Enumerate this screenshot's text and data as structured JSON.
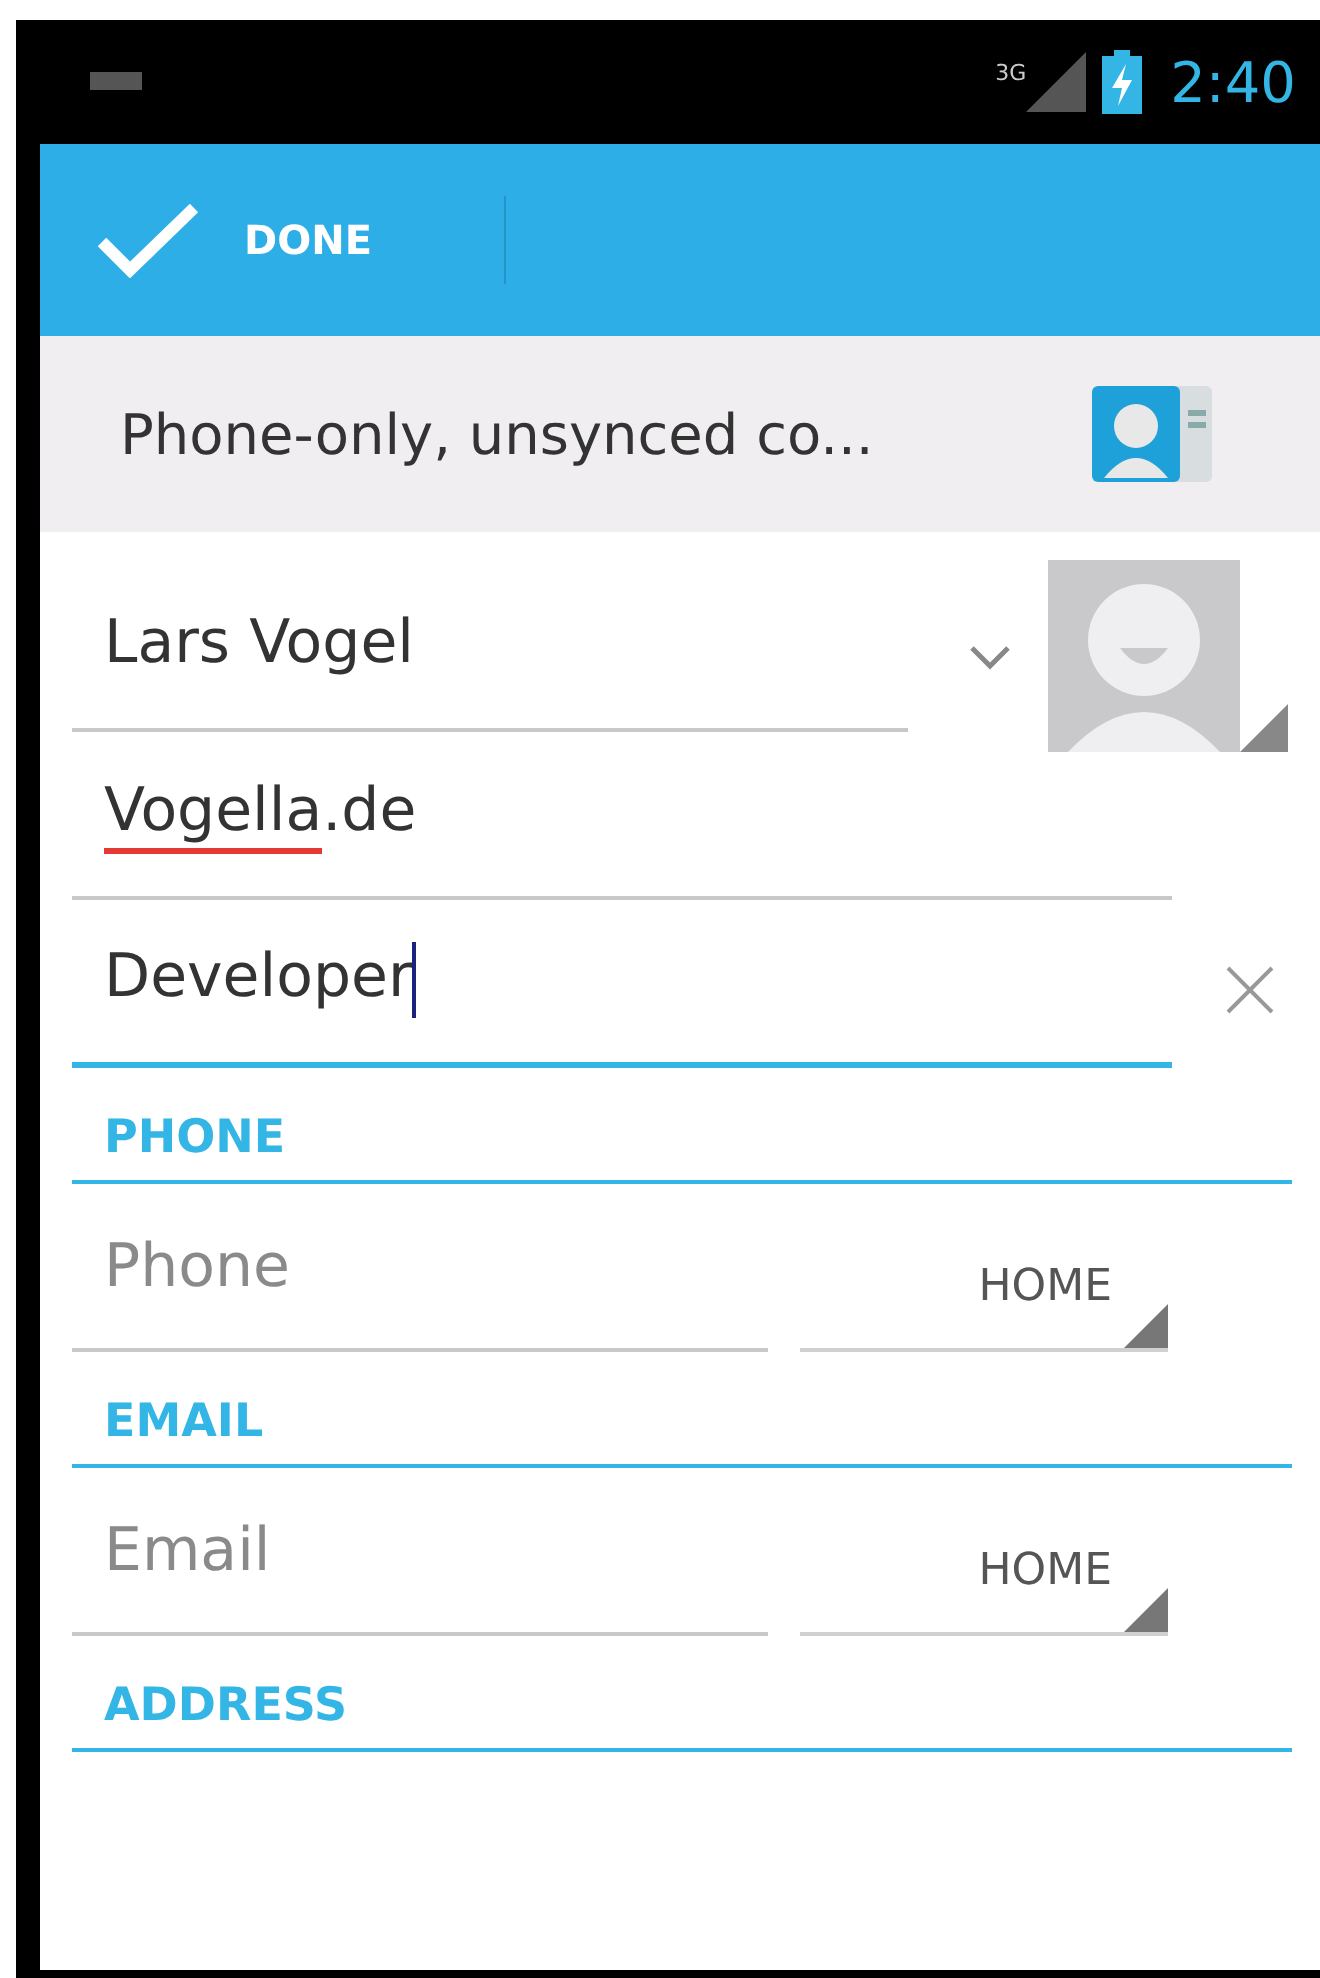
{
  "status_bar": {
    "network": "3G",
    "time": "2:40"
  },
  "action_bar": {
    "done_label": "DONE"
  },
  "account": {
    "label": "Phone-only, unsynced co..."
  },
  "fields": [
    {
      "kind": "name",
      "parts": [
        {
          "text": "Lars Vogel",
          "misspelled": false
        }
      ],
      "focused": false
    },
    {
      "kind": "plain",
      "parts": [
        {
          "text": "Vogella",
          "misspelled": true
        },
        {
          "text": ".de",
          "misspelled": false
        }
      ],
      "focused": false
    },
    {
      "kind": "clearable",
      "parts": [
        {
          "text": "Developer",
          "misspelled": false
        }
      ],
      "focused": true
    }
  ],
  "sections": [
    {
      "title": "PHONE",
      "placeholder": "Phone",
      "type": "HOME"
    },
    {
      "title": "EMAIL",
      "placeholder": "Email",
      "type": "HOME"
    },
    {
      "title": "ADDRESS"
    }
  ]
}
